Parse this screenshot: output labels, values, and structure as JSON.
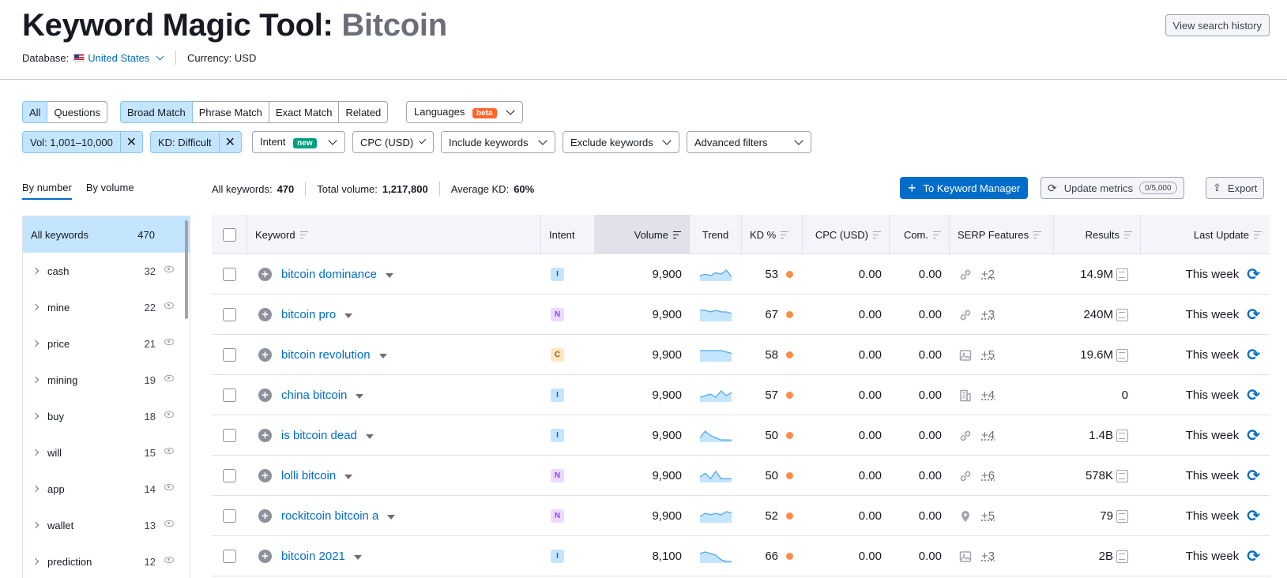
{
  "header": {
    "title": "Keyword Magic Tool:",
    "keyword": "Bitcoin",
    "database_label": "Database:",
    "database_value": "United States",
    "currency_label": "Currency:",
    "currency_value": "USD",
    "view_history": "View search history"
  },
  "filters": {
    "type_tabs": [
      "All",
      "Questions"
    ],
    "match_tabs": [
      "Broad Match",
      "Phrase Match",
      "Exact Match",
      "Related"
    ],
    "languages": "Languages",
    "languages_badge": "beta",
    "vol_chip": "Vol: 1,001–10,000",
    "kd_chip": "KD: Difficult",
    "intent": "Intent",
    "intent_badge": "new",
    "cpc": "CPC (USD)",
    "include": "Include keywords",
    "exclude": "Exclude keywords",
    "advanced": "Advanced filters"
  },
  "sort_tabs": [
    "By number",
    "By volume"
  ],
  "stats": {
    "all_label": "All keywords:",
    "all_value": "470",
    "volume_label": "Total volume:",
    "volume_value": "1,217,800",
    "kd_label": "Average KD:",
    "kd_value": "60%"
  },
  "actions": {
    "to_manager": "To Keyword Manager",
    "update_metrics": "Update metrics",
    "update_count": "0/5,000",
    "export": "Export"
  },
  "sidebar": {
    "all_label": "All keywords",
    "all_count": "470",
    "items": [
      {
        "label": "cash",
        "count": "32"
      },
      {
        "label": "mine",
        "count": "22"
      },
      {
        "label": "price",
        "count": "21"
      },
      {
        "label": "mining",
        "count": "19"
      },
      {
        "label": "buy",
        "count": "18"
      },
      {
        "label": "will",
        "count": "15"
      },
      {
        "label": "app",
        "count": "14"
      },
      {
        "label": "wallet",
        "count": "13"
      },
      {
        "label": "prediction",
        "count": "12"
      }
    ]
  },
  "table": {
    "headers": {
      "keyword": "Keyword",
      "intent": "Intent",
      "volume": "Volume",
      "trend": "Trend",
      "kd": "KD %",
      "cpc": "CPC (USD)",
      "com": "Com.",
      "serp": "SERP Features",
      "results": "Results",
      "last_update": "Last Update"
    },
    "rows": [
      {
        "keyword": "bitcoin dominance",
        "intent": "I",
        "volume": "9,900",
        "trend": [
          4,
          5,
          4,
          6,
          5,
          8,
          3
        ],
        "kd": "53",
        "cpc": "0.00",
        "com": "0.00",
        "serp_icon": "link-icon",
        "serp_more": "+2",
        "results": "14.9M",
        "updated": "This week"
      },
      {
        "keyword": "bitcoin pro",
        "intent": "N",
        "volume": "9,900",
        "trend": [
          7,
          7,
          6,
          7,
          6,
          6,
          5
        ],
        "kd": "67",
        "cpc": "0.00",
        "com": "0.00",
        "serp_icon": "link-icon",
        "serp_more": "+3",
        "results": "240M",
        "updated": "This week"
      },
      {
        "keyword": "bitcoin revolution",
        "intent": "C",
        "volume": "9,900",
        "trend": [
          8,
          8,
          8,
          8,
          8,
          7,
          6
        ],
        "kd": "58",
        "cpc": "0.00",
        "com": "0.00",
        "serp_icon": "image-icon",
        "serp_more": "+5",
        "results": "19.6M",
        "updated": "This week"
      },
      {
        "keyword": "china bitcoin",
        "intent": "I",
        "volume": "9,900",
        "trend": [
          3,
          4,
          5,
          3,
          7,
          4,
          6
        ],
        "kd": "57",
        "cpc": "0.00",
        "com": "0.00",
        "serp_icon": "building-icon",
        "serp_more": "+4",
        "results": "0",
        "updated": "This week"
      },
      {
        "keyword": "is bitcoin dead",
        "intent": "I",
        "volume": "9,900",
        "trend": [
          2,
          5,
          3,
          2,
          1,
          1,
          1
        ],
        "kd": "50",
        "cpc": "0.00",
        "com": "0.00",
        "serp_icon": "link-icon",
        "serp_more": "+4",
        "results": "1.4B",
        "updated": "This week"
      },
      {
        "keyword": "lolli bitcoin",
        "intent": "N",
        "volume": "9,900",
        "trend": [
          3,
          5,
          2,
          6,
          2,
          2,
          2
        ],
        "kd": "50",
        "cpc": "0.00",
        "com": "0.00",
        "serp_icon": "link-icon",
        "serp_more": "+6",
        "results": "578K",
        "updated": "This week"
      },
      {
        "keyword": "rockitcoin bitcoin a",
        "intent": "N",
        "volume": "9,900",
        "trend": [
          4,
          6,
          5,
          6,
          5,
          7,
          6
        ],
        "kd": "52",
        "cpc": "0.00",
        "com": "0.00",
        "serp_icon": "pin-icon",
        "serp_more": "+5",
        "results": "79",
        "updated": "This week"
      },
      {
        "keyword": "bitcoin 2021",
        "intent": "I",
        "volume": "8,100",
        "trend": [
          6,
          7,
          6,
          5,
          2,
          1,
          1
        ],
        "kd": "66",
        "cpc": "0.00",
        "com": "0.00",
        "serp_icon": "image-icon",
        "serp_more": "+3",
        "results": "2B",
        "updated": "This week"
      }
    ]
  },
  "colors": {
    "accent": "#006dca",
    "selected_bg": "#c4e5fe",
    "kd_dot": "#ff8c43"
  }
}
